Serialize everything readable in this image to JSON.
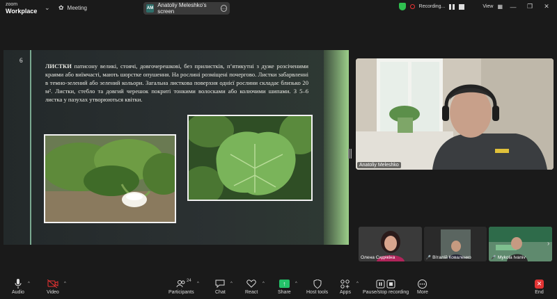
{
  "app": {
    "logo_line1": "zoom",
    "logo_line2": "Workplace",
    "meeting_label": "Meeting",
    "share_initials": "AM",
    "share_label": "Anatoliy Meleshko's screen",
    "recording_label": "Recording...",
    "view_label": "View"
  },
  "slide": {
    "number": "6",
    "heading": "ЛИСТКИ",
    "body": " патисону великі, стоячі, довгочерешкові, без прилистків, п’ятикутні з дуже розсіченими краями або виїмчасті, мають шорстке опушення. На рослині розміщені почергово. Листки забарвленні в темно-зелений або зелений кольори. Загальна листкова поверхня однієї рослини складає близько 20 м². Листки, стебло та довгий черешок покриті тонкими волосками або колючими шипами. З 5–6 листка у пазухах утворюються квітки."
  },
  "speaker": {
    "name": "Anatoliy Meleshko"
  },
  "participants": [
    {
      "name": "Олена Сидякіна",
      "muted": false
    },
    {
      "name": "Віталій Коваленко",
      "muted": true
    },
    {
      "name": "Mykola Ivaniv",
      "muted": true
    }
  ],
  "toolbar": {
    "audio": "Audio",
    "video": "Video",
    "participants": "Participants",
    "participants_count": "24",
    "chat": "Chat",
    "react": "React",
    "share": "Share",
    "host_tools": "Host tools",
    "apps": "Apps",
    "record": "Pause/stop recording",
    "more": "More",
    "end": "End"
  },
  "colors": {
    "share_green": "#23c268",
    "end_red": "#e23434",
    "secure_green": "#2fbf4f"
  }
}
